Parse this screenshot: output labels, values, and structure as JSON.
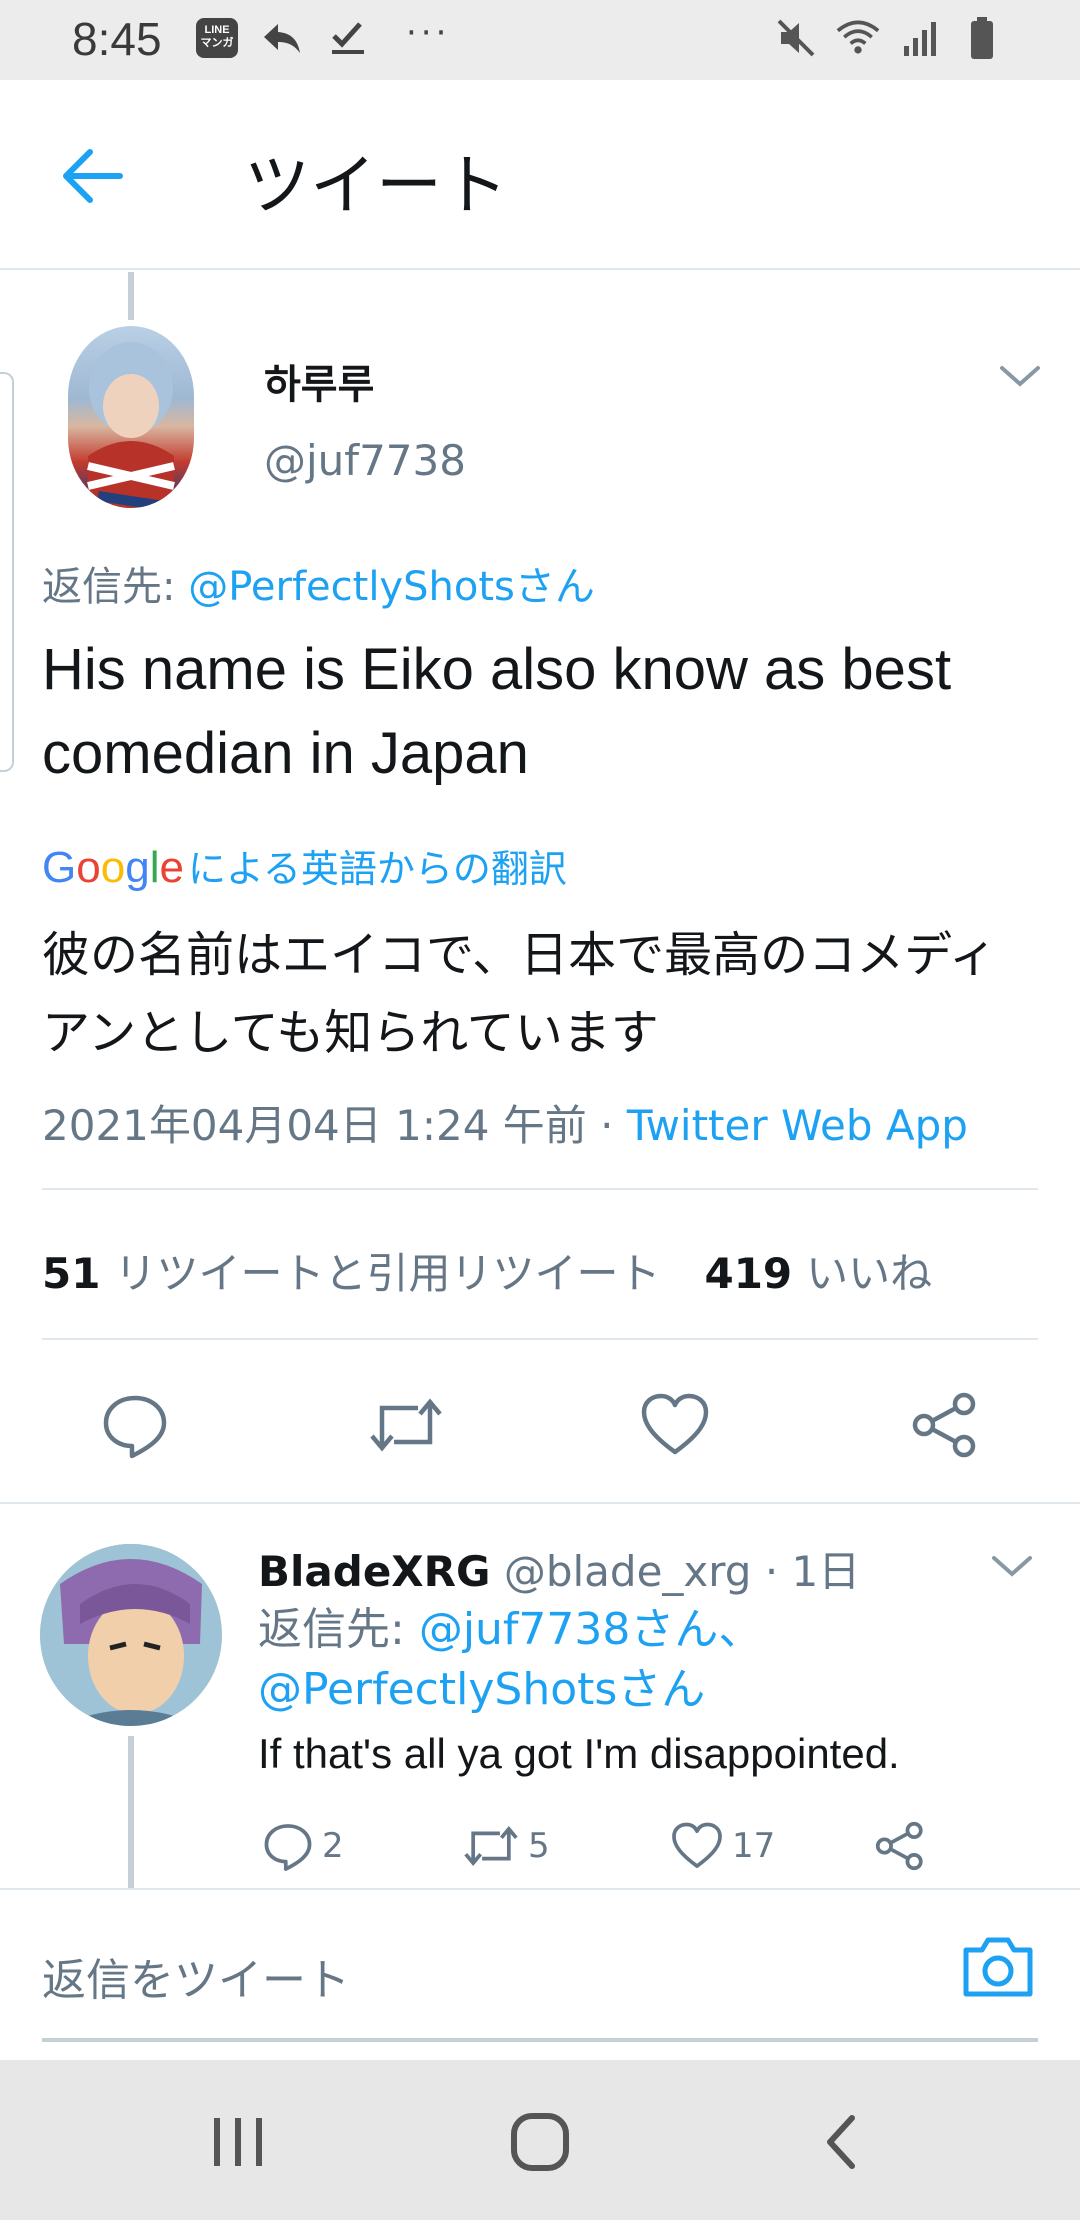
{
  "status_bar": {
    "time": "8:45",
    "line_badge_text": "LINE\nマンガ",
    "left_icons": [
      "line-manga-icon",
      "reply-arrow-icon",
      "check-icon",
      "more-dots-icon"
    ],
    "right_icons": [
      "mute-icon",
      "wifi-icon",
      "signal-icon",
      "battery-icon"
    ],
    "more": "···"
  },
  "header": {
    "title": "ツイート"
  },
  "tweet": {
    "author_name": "하루루",
    "author_handle": "@juf7738",
    "reply_to_label": "返信先: ",
    "reply_to_mention": "@PerfectlyShotsさん",
    "text": "His name is Eiko also know as best comedian in Japan",
    "translation_source": "Google",
    "translation_label": "による英語からの翻訳",
    "translated_text": "彼の名前はエイコで、日本で最高のコメディアンとしても知られています",
    "datetime": "2021年04月04日 1:24 午前",
    "separator": " · ",
    "client": "Twitter Web App",
    "retweets_count": "51",
    "retweets_label": "リツイートと引用リツイート",
    "likes_count": "419",
    "likes_label": "いいね"
  },
  "reply": {
    "name": "BladeXRG",
    "handle_time": " @blade_xrg · 1日",
    "reply_to_label": "返信先: ",
    "reply_to_mentions": "@juf7738さん、@PerfectlyShotsさん",
    "text": "If that's all ya got I'm disappointed.",
    "reply_count": "2",
    "retweet_count": "5",
    "like_count": "17"
  },
  "compose": {
    "placeholder": "返信をツイート"
  },
  "colors": {
    "accent": "#1da1f2",
    "muted": "#657786",
    "text": "#14171a",
    "divider": "#e1e8ed"
  }
}
